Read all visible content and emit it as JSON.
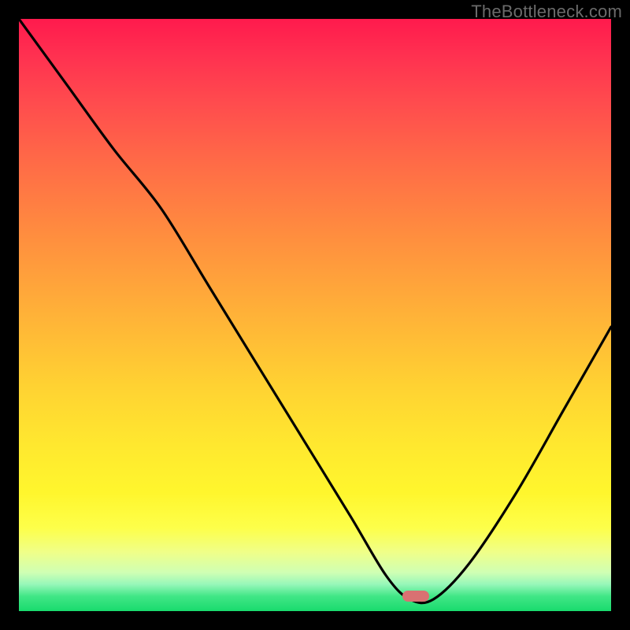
{
  "watermark": "TheBottleneck.com",
  "marker": {
    "x_pct": 67,
    "y_pct": 97.5,
    "color": "#d97172"
  },
  "chart_data": {
    "type": "line",
    "title": "",
    "xlabel": "",
    "ylabel": "",
    "xlim": [
      0,
      100
    ],
    "ylim": [
      0,
      100
    ],
    "grid": false,
    "series": [
      {
        "name": "curve",
        "x": [
          0,
          8,
          16,
          24,
          32,
          40,
          48,
          56,
          62,
          66,
          70,
          76,
          84,
          92,
          100
        ],
        "y": [
          100,
          89,
          78,
          68,
          55,
          42,
          29,
          16,
          6,
          2,
          2,
          8,
          20,
          34,
          48
        ]
      }
    ],
    "annotations": [
      {
        "type": "marker",
        "x": 67,
        "y": 2.5,
        "color": "#d97172"
      }
    ],
    "background_gradient": {
      "stops": [
        {
          "pct": 0,
          "color": "#ff1a4d"
        },
        {
          "pct": 50,
          "color": "#ffb238"
        },
        {
          "pct": 80,
          "color": "#fff62d"
        },
        {
          "pct": 100,
          "color": "#19db6d"
        }
      ]
    }
  }
}
